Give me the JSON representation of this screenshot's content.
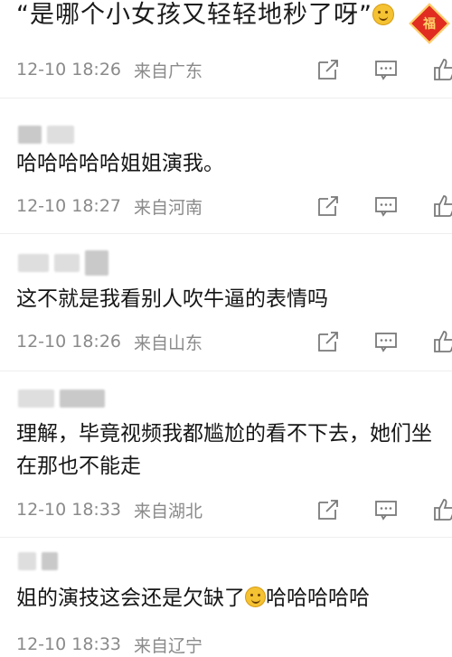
{
  "top": {
    "text": "“是哪个小女孩又轻轻地秒了呀”",
    "badge": "福"
  },
  "comments": [
    {
      "meta": {
        "time": "12-10 18:26",
        "location": "来自广东"
      }
    },
    {
      "text": "哈哈哈哈哈姐姐演我。",
      "meta": {
        "time": "12-10 18:27",
        "location": "来自河南"
      }
    },
    {
      "text": "这不就是我看别人吹牛逼的表情吗",
      "meta": {
        "time": "12-10 18:26",
        "location": "来自山东"
      }
    },
    {
      "text": "理解，毕竟视频我都尴尬的看不下去，她们坐在那也不能走",
      "meta": {
        "time": "12-10 18:33",
        "location": "来自湖北"
      }
    },
    {
      "text": "姐的演技这会还是欠缺了",
      "text_after_emoji": "哈哈哈哈哈",
      "meta": {
        "time": "12-10 18:33",
        "location": "来自辽宁"
      }
    }
  ],
  "icons": {
    "share": "share-icon",
    "comment": "comment-icon",
    "like": "thumbs-up-icon"
  }
}
